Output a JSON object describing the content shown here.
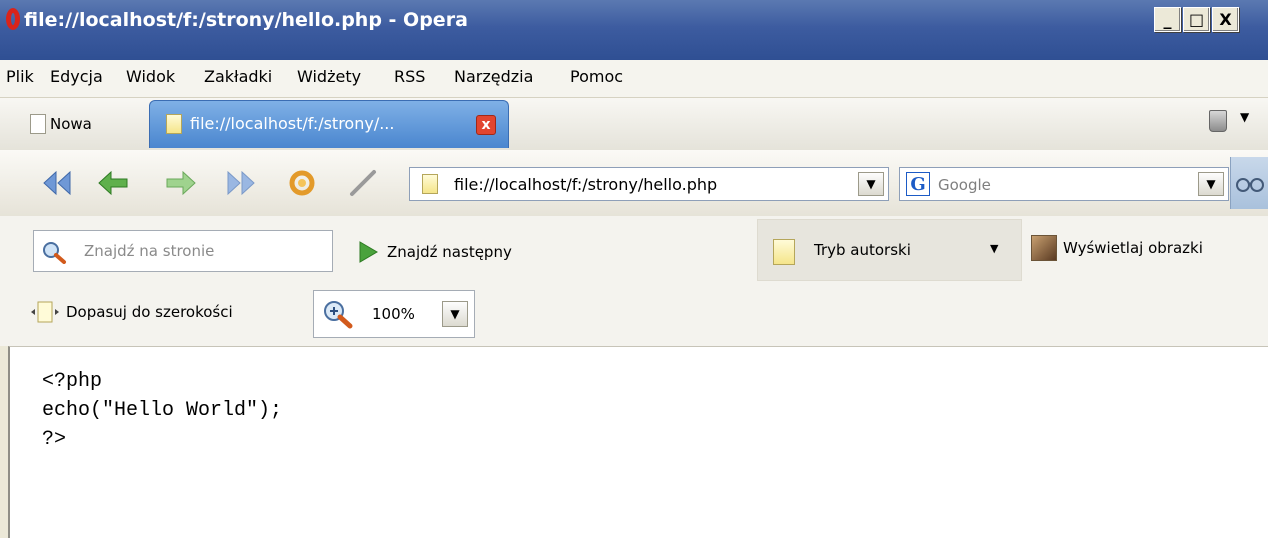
{
  "window": {
    "title": "file://localhost/f:/strony/hello.php - Opera",
    "controls": {
      "minimize": "_",
      "maximize": "□",
      "close": "X"
    }
  },
  "menu": [
    "Plik",
    "Edycja",
    "Widok",
    "Zakładki",
    "Widżety",
    "RSS",
    "Narzędzia",
    "Pomoc"
  ],
  "tabs": {
    "new_tab_label": "Nowa",
    "active_tab_label": "file://localhost/f:/strony/...",
    "close_glyph": "x"
  },
  "navigation": {
    "address_value": "file://localhost/f:/strony/hello.php",
    "search_engine_icon": "G",
    "search_placeholder": "Google",
    "dropdown_glyph": "▼",
    "icons": [
      "rewind-icon",
      "back-icon",
      "forward-icon",
      "fast-forward-icon",
      "reload-icon",
      "wand-icon",
      "glasses-icon"
    ]
  },
  "find_toolbar": {
    "find_placeholder": "Znajdź na stronie",
    "find_next_label": "Znajdź następny",
    "author_mode_label": "Tryb autorski",
    "show_images_label": "Wyświetlaj obrazki",
    "fit_width_label": "Dopasuj do szerokości",
    "zoom_value": "100%"
  },
  "page": {
    "code_lines": [
      "<?php",
      "echo(\"Hello World\");",
      "?>"
    ]
  },
  "colors": {
    "titlebar": "#3d5ca0",
    "active_tab": "#4a86cf",
    "close_red": "#e2452f",
    "background": "#ece9d8"
  }
}
